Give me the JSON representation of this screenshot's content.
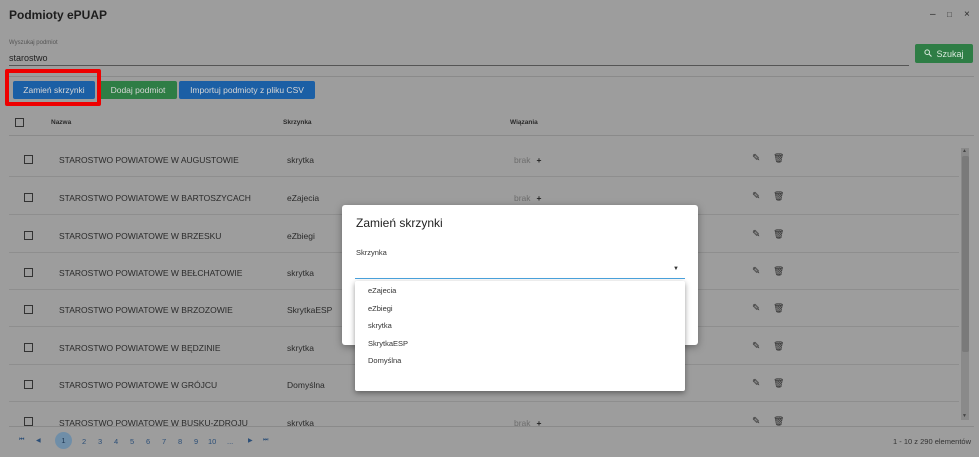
{
  "window": {
    "title": "Podmioty ePUAP",
    "controls": [
      "–",
      "□",
      "×"
    ]
  },
  "search": {
    "label": "Wyszukaj podmiot",
    "value": "starostwo",
    "button_label": "Szukaj",
    "button_icon": "search-icon"
  },
  "toolbar": {
    "swap_label": "Zamień skrzynki",
    "add_label": "Dodaj podmiot",
    "import_label": "Importuj podmioty z pliku CSV",
    "highlight_color": "#ee0000"
  },
  "table": {
    "columns": [
      "Nazwa",
      "Skrzynka",
      "Wiązania"
    ],
    "rows": [
      {
        "name": "STAROSTWO POWIATOWE W AUGUSTOWIE",
        "box": "skrytka",
        "binding": "brak"
      },
      {
        "name": "STAROSTWO POWIATOWE W BARTOSZYCACH",
        "box": "eZajecia",
        "binding": "brak"
      },
      {
        "name": "STAROSTWO POWIATOWE W BRZESKU",
        "box": "eZbiegi",
        "binding": ""
      },
      {
        "name": "STAROSTWO POWIATOWE W BEŁCHATOWIE",
        "box": "skrytka",
        "binding": ""
      },
      {
        "name": "STAROSTWO POWIATOWE W BRZOZOWIE",
        "box": "SkrytkaESP",
        "binding": ""
      },
      {
        "name": "STAROSTWO POWIATOWE W BĘDZINIE",
        "box": "skrytka",
        "binding": ""
      },
      {
        "name": "STAROSTWO POWIATOWE W GRÓJCU",
        "box": "Domyślna",
        "binding": ""
      },
      {
        "name": "STAROSTWO POWIATOWE W BUSKU-ZDROJU",
        "box": "skrytka",
        "binding": "brak"
      }
    ]
  },
  "pager": {
    "first": "⏮",
    "prev": "◀",
    "pages": [
      "1",
      "2",
      "3",
      "4",
      "5",
      "6",
      "7",
      "8",
      "9",
      "10",
      "..."
    ],
    "next": "▶",
    "last": "⏭",
    "active_page": "1",
    "info": "1 - 10 z 290 elementów"
  },
  "modal": {
    "title": "Zamień skrzynki",
    "field_label": "Skrzynka",
    "options": [
      "eZajecia",
      "eZbiegi",
      "skrytka",
      "SkrytkaESP",
      "Domyślna"
    ]
  }
}
